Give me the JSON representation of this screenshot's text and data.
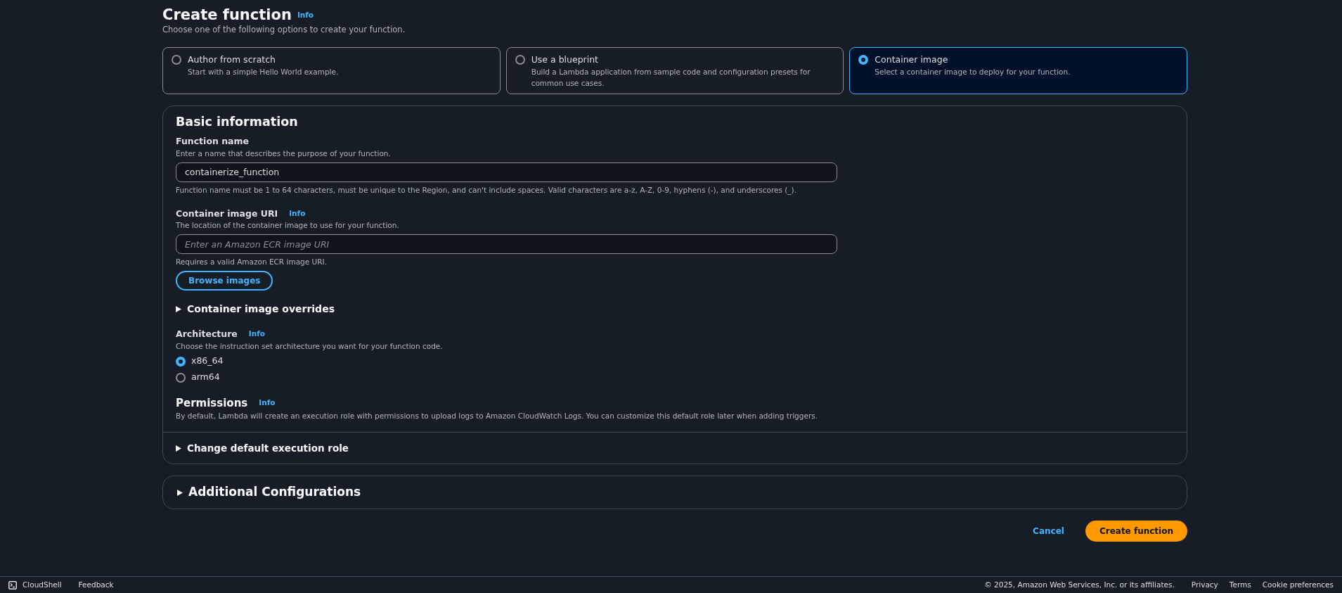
{
  "header": {
    "title": "Create function",
    "info": "Info",
    "description": "Choose one of the following options to create your function."
  },
  "options": [
    {
      "title": "Author from scratch",
      "description": "Start with a simple Hello World example.",
      "selected": false
    },
    {
      "title": "Use a blueprint",
      "description": "Build a Lambda application from sample code and configuration presets for common use cases.",
      "selected": false
    },
    {
      "title": "Container image",
      "description": "Select a container image to deploy for your function.",
      "selected": true
    }
  ],
  "basic_information": {
    "title": "Basic information",
    "function_name": {
      "label": "Function name",
      "description": "Enter a name that describes the purpose of your function.",
      "value": "containerize_function",
      "constraint": "Function name must be 1 to 64 characters, must be unique to the Region, and can't include spaces. Valid characters are a-z, A-Z, 0-9, hyphens (-), and underscores (_)."
    },
    "container_image_uri": {
      "label": "Container image URI",
      "info": "Info",
      "description": "The location of the container image to use for your function.",
      "placeholder": "Enter an Amazon ECR image URI",
      "constraint": "Requires a valid Amazon ECR image URI.",
      "button": "Browse images"
    },
    "overrides": {
      "label": "Container image overrides",
      "expanded": false
    },
    "architecture": {
      "label": "Architecture",
      "info": "Info",
      "description": "Choose the instruction set architecture you want for your function code.",
      "options": [
        {
          "label": "x86_64",
          "selected": true
        },
        {
          "label": "arm64",
          "selected": false
        }
      ]
    },
    "permissions": {
      "title": "Permissions",
      "info": "Info",
      "description": "By default, Lambda will create an execution role with permissions to upload logs to Amazon CloudWatch Logs. You can customize this default role later when adding triggers."
    },
    "execution_role": {
      "label": "Change default execution role",
      "expanded": false
    }
  },
  "additional_configurations": {
    "label": "Additional Configurations",
    "expanded": false
  },
  "actions": {
    "cancel": "Cancel",
    "submit": "Create function"
  },
  "footer": {
    "cloudshell": "CloudShell",
    "feedback": "Feedback",
    "copyright": "© 2025, Amazon Web Services, Inc. or its affiliates.",
    "links": [
      "Privacy",
      "Terms",
      "Cookie preferences"
    ]
  }
}
